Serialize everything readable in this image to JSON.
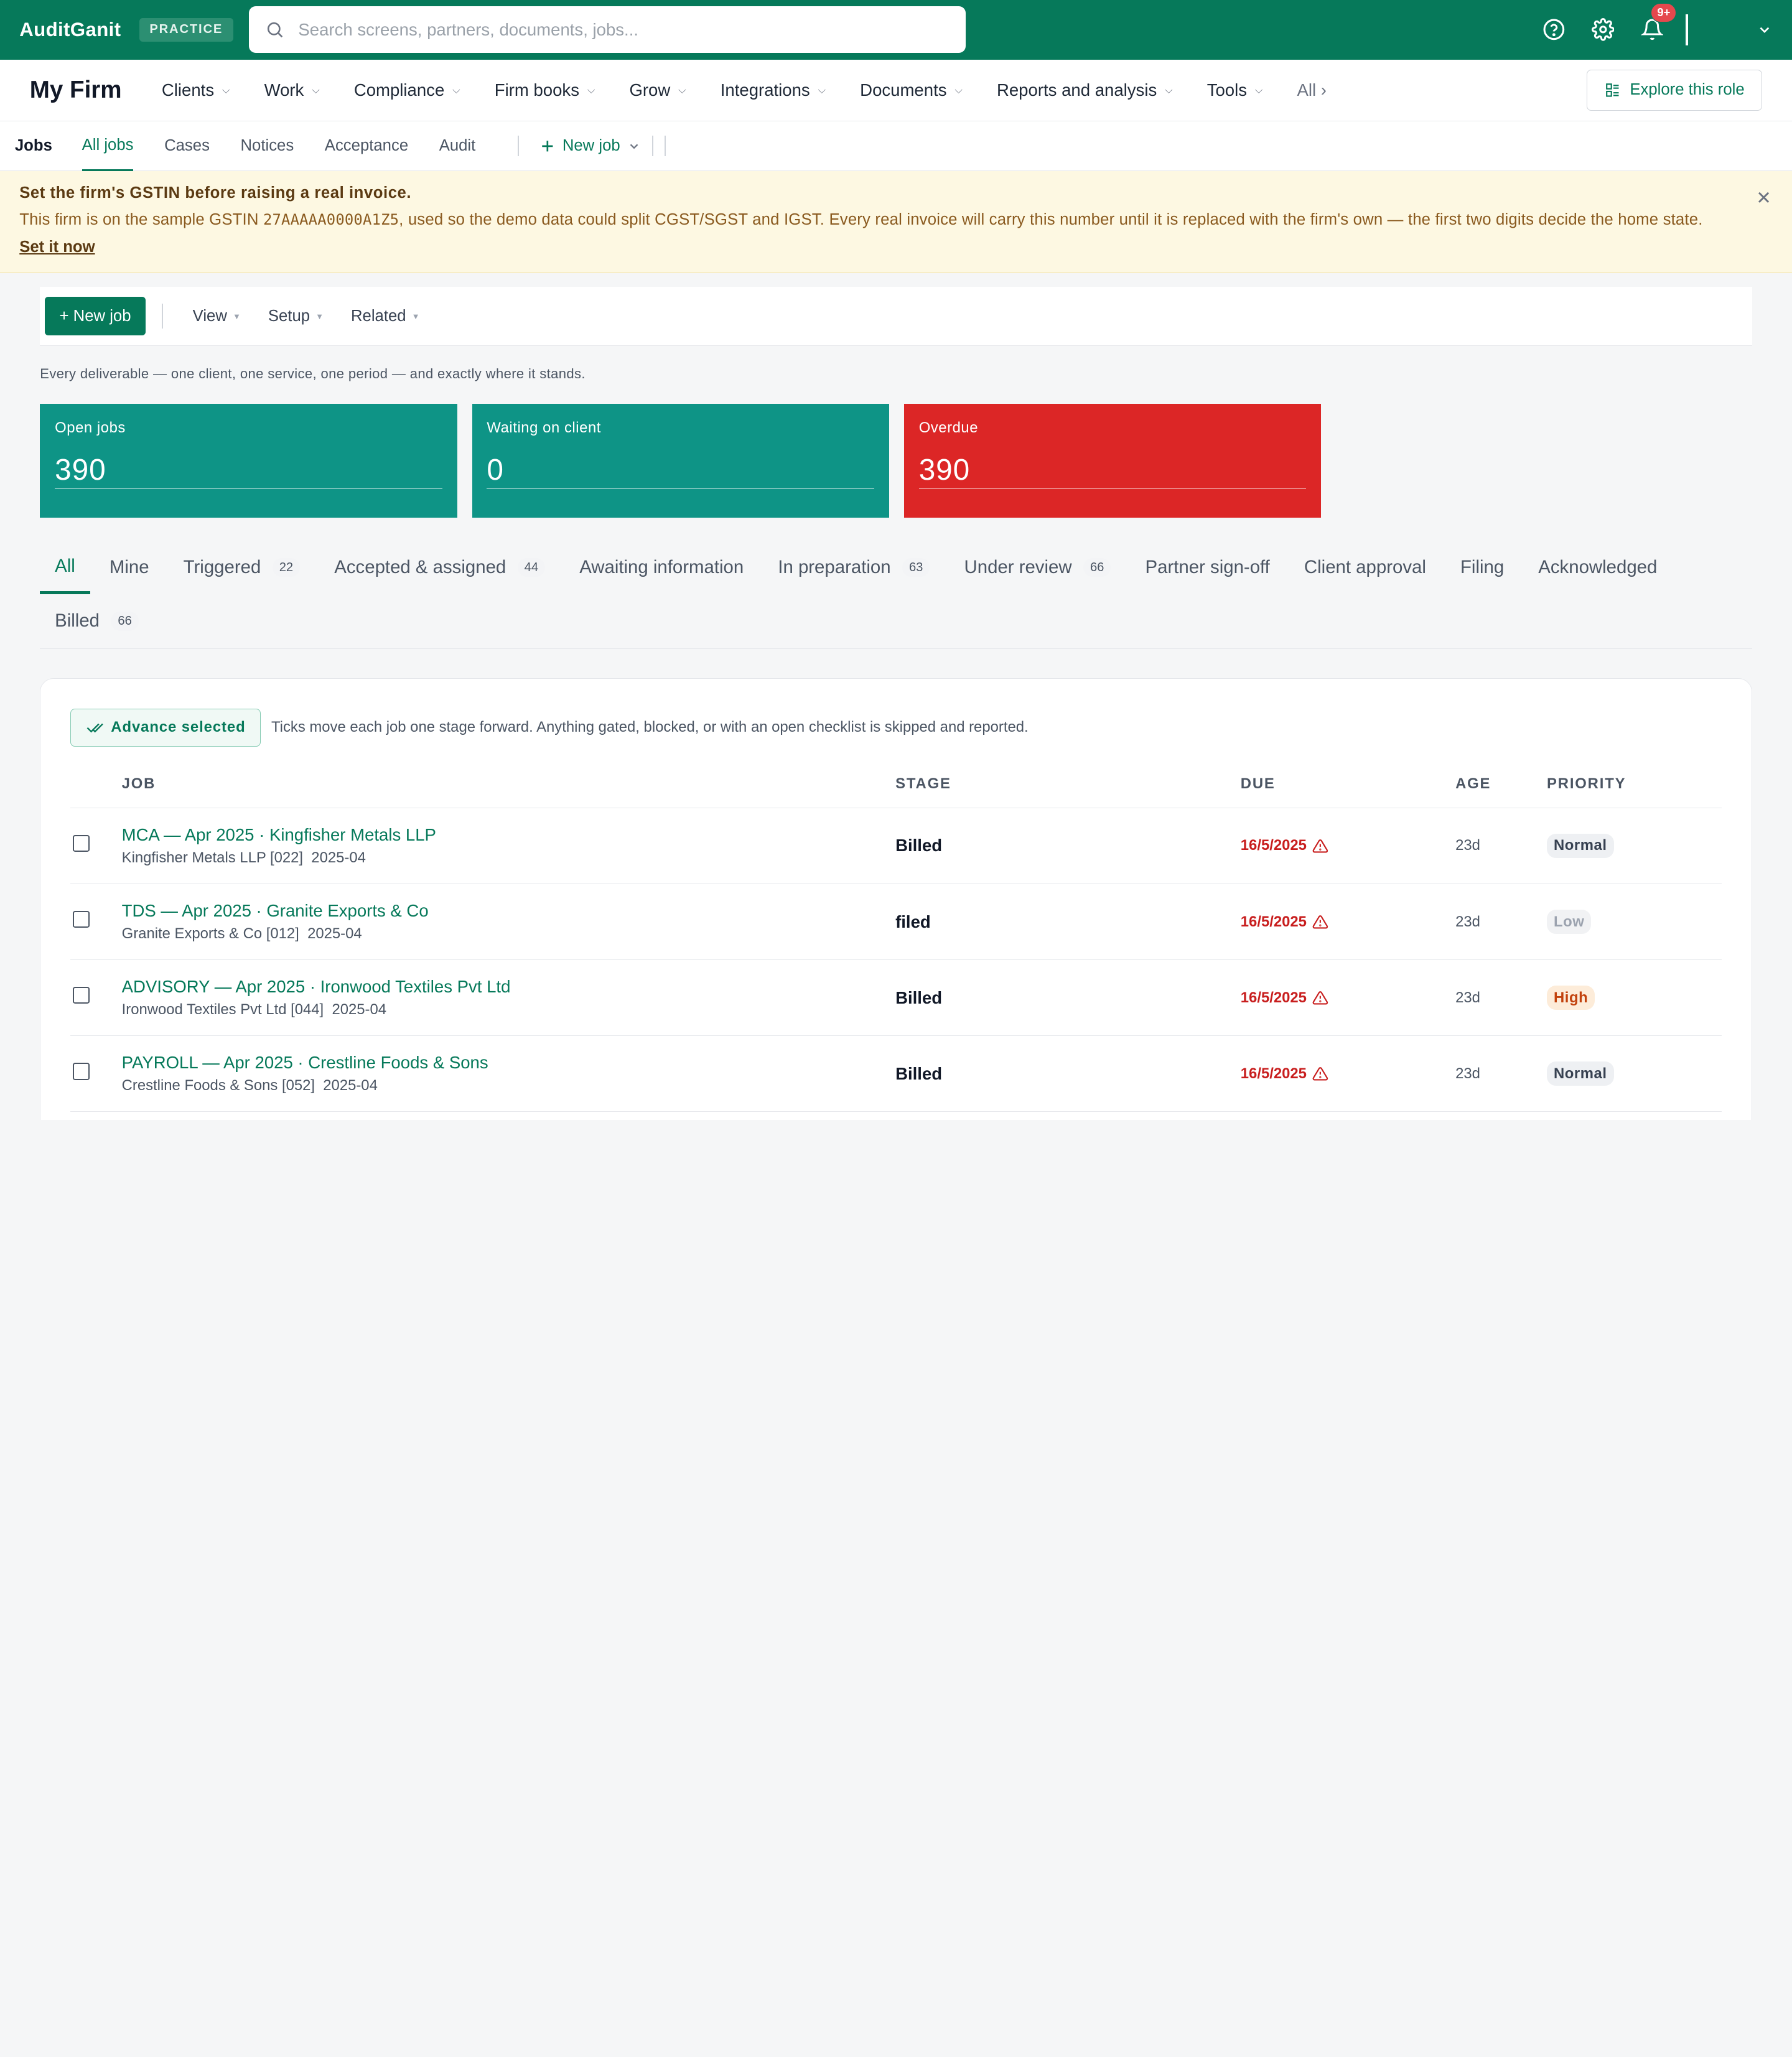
{
  "app": {
    "name": "AuditGanit",
    "badge": "PRACTICE",
    "search_placeholder": "Search screens, partners, documents, jobs...",
    "notif_count": "9+"
  },
  "nav": {
    "firm": "My Firm",
    "items": [
      "Clients",
      "Work",
      "Compliance",
      "Firm books",
      "Grow",
      "Integrations",
      "Documents",
      "Reports and analysis",
      "Tools"
    ],
    "all": "All ›",
    "explore": "Explore this role"
  },
  "subnav": {
    "lead": "Jobs",
    "tabs": [
      "All jobs",
      "Cases",
      "Notices",
      "Acceptance",
      "Audit"
    ],
    "new_job": "New job"
  },
  "alert": {
    "title": "Set the firm's GSTIN before raising a real invoice.",
    "body_pre": "This firm is on the sample GSTIN ",
    "gstin": "27AAAAA0000A1Z5",
    "body_post": ", used so the demo data could split CGST/SGST and IGST. Every real invoice will carry this number until it is replaced with the firm's own — the first two digits decide the home state.",
    "link": "Set it now"
  },
  "toolbar": {
    "primary": "+ New job",
    "menus": [
      "View",
      "Setup",
      "Related"
    ]
  },
  "description": "Every deliverable — one client, one service, one period — and exactly where it stands.",
  "kpis": [
    {
      "label": "Open jobs",
      "value": "390"
    },
    {
      "label": "Waiting on client",
      "value": "0"
    },
    {
      "label": "Overdue",
      "value": "390"
    }
  ],
  "stages": [
    {
      "label": "All",
      "count": ""
    },
    {
      "label": "Mine",
      "count": ""
    },
    {
      "label": "Triggered",
      "count": "22"
    },
    {
      "label": "Accepted & assigned",
      "count": "44"
    },
    {
      "label": "Awaiting information",
      "count": ""
    },
    {
      "label": "In preparation",
      "count": "63"
    },
    {
      "label": "Under review",
      "count": "66"
    },
    {
      "label": "Partner sign-off",
      "count": ""
    },
    {
      "label": "Client approval",
      "count": ""
    },
    {
      "label": "Filing",
      "count": ""
    },
    {
      "label": "Acknowledged",
      "count": ""
    },
    {
      "label": "Billed",
      "count": "66"
    }
  ],
  "advance": {
    "label": "Advance selected",
    "help": "Ticks move each job one stage forward. Anything gated, blocked, or with an open checklist is skipped and reported."
  },
  "table": {
    "columns": [
      "JOB",
      "STAGE",
      "DUE",
      "AGE",
      "PRIORITY"
    ],
    "rows": [
      {
        "title": "MCA — Apr 2025 · Kingfisher Metals LLP",
        "client": "Kingfisher Metals LLP [022]",
        "period": "2025-04",
        "stage": "Billed",
        "due": "16/5/2025",
        "age": "23d",
        "priority": "Normal"
      },
      {
        "title": "TDS — Apr 2025 · Granite Exports & Co",
        "client": "Granite Exports & Co [012]",
        "period": "2025-04",
        "stage": "filed",
        "due": "16/5/2025",
        "age": "23d",
        "priority": "Low"
      },
      {
        "title": "ADVISORY — Apr 2025 · Ironwood Textiles Pvt Ltd",
        "client": "Ironwood Textiles Pvt Ltd [044]",
        "period": "2025-04",
        "stage": "Billed",
        "due": "16/5/2025",
        "age": "23d",
        "priority": "High"
      },
      {
        "title": "PAYROLL — Apr 2025 · Crestline Foods & Sons",
        "client": "Crestline Foods & Sons [052]",
        "period": "2025-04",
        "stage": "Billed",
        "due": "16/5/2025",
        "age": "23d",
        "priority": "Normal"
      }
    ]
  },
  "colors": {
    "brand": "#06795a",
    "kpi_teal": "#0e9486",
    "kpi_red": "#dc2626",
    "overdue": "#c81e1e"
  }
}
